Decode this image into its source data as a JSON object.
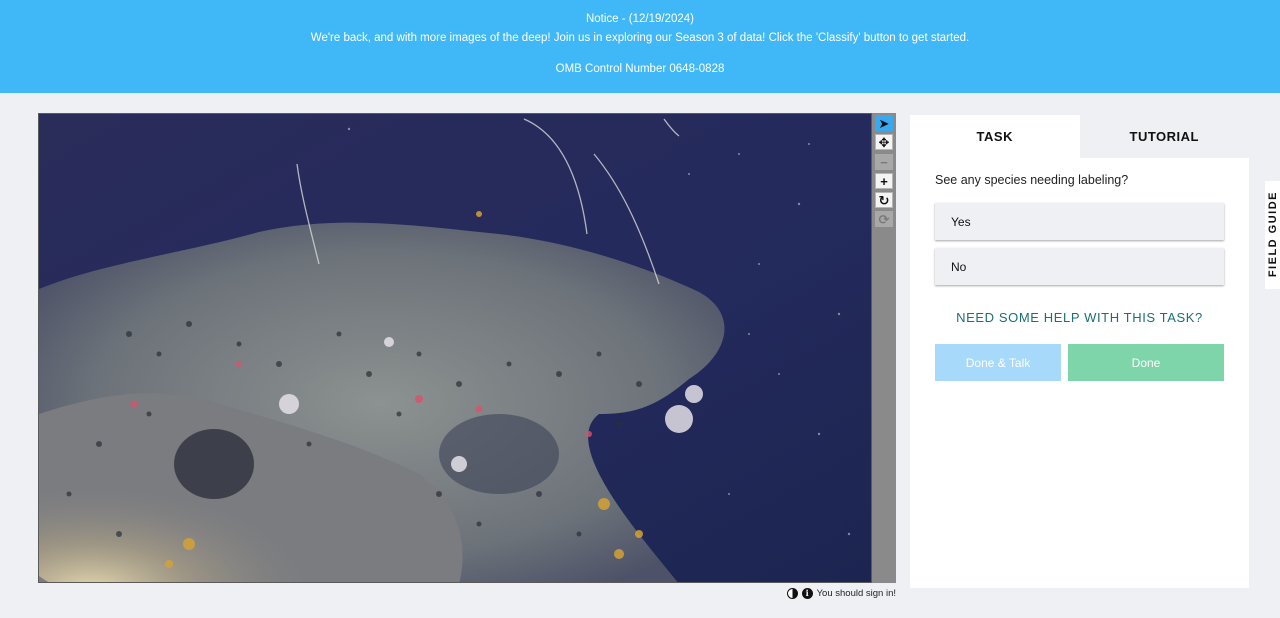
{
  "notice": {
    "title": "Notice - (12/19/2024)",
    "message": "We're back, and with more images of the deep! Join us in exploring our Season 3 of data! Click the 'Classify' button to get started.",
    "omb": "OMB Control Number 0648-0828"
  },
  "viewer": {
    "tools": [
      {
        "name": "pointer-icon",
        "glyph": "➤",
        "state": "active"
      },
      {
        "name": "move-icon",
        "glyph": "✥",
        "state": "normal"
      },
      {
        "name": "zoom-out-icon",
        "glyph": "−",
        "state": "disabled"
      },
      {
        "name": "zoom-in-icon",
        "glyph": "+",
        "state": "normal"
      },
      {
        "name": "rotate-icon",
        "glyph": "↻",
        "state": "normal"
      },
      {
        "name": "reset-icon",
        "glyph": "⟳",
        "state": "disabled"
      }
    ]
  },
  "footer": {
    "signin": "You should sign in!"
  },
  "panel": {
    "tabs": {
      "task": "TASK",
      "tutorial": "TUTORIAL"
    },
    "question": "See any species needing labeling?",
    "answers": {
      "yes": "Yes",
      "no": "No"
    },
    "help": "NEED SOME HELP WITH THIS TASK?",
    "buttons": {
      "done_talk": "Done & Talk",
      "done": "Done"
    }
  },
  "field_guide": {
    "label": "FIELD GUIDE"
  },
  "colors": {
    "notice_bg": "#40b8f8",
    "active_tool": "#3aa8ef",
    "help_text": "#1c6f72",
    "done_talk_bg": "#a7d9fb",
    "done_bg": "#7dd5a9"
  }
}
